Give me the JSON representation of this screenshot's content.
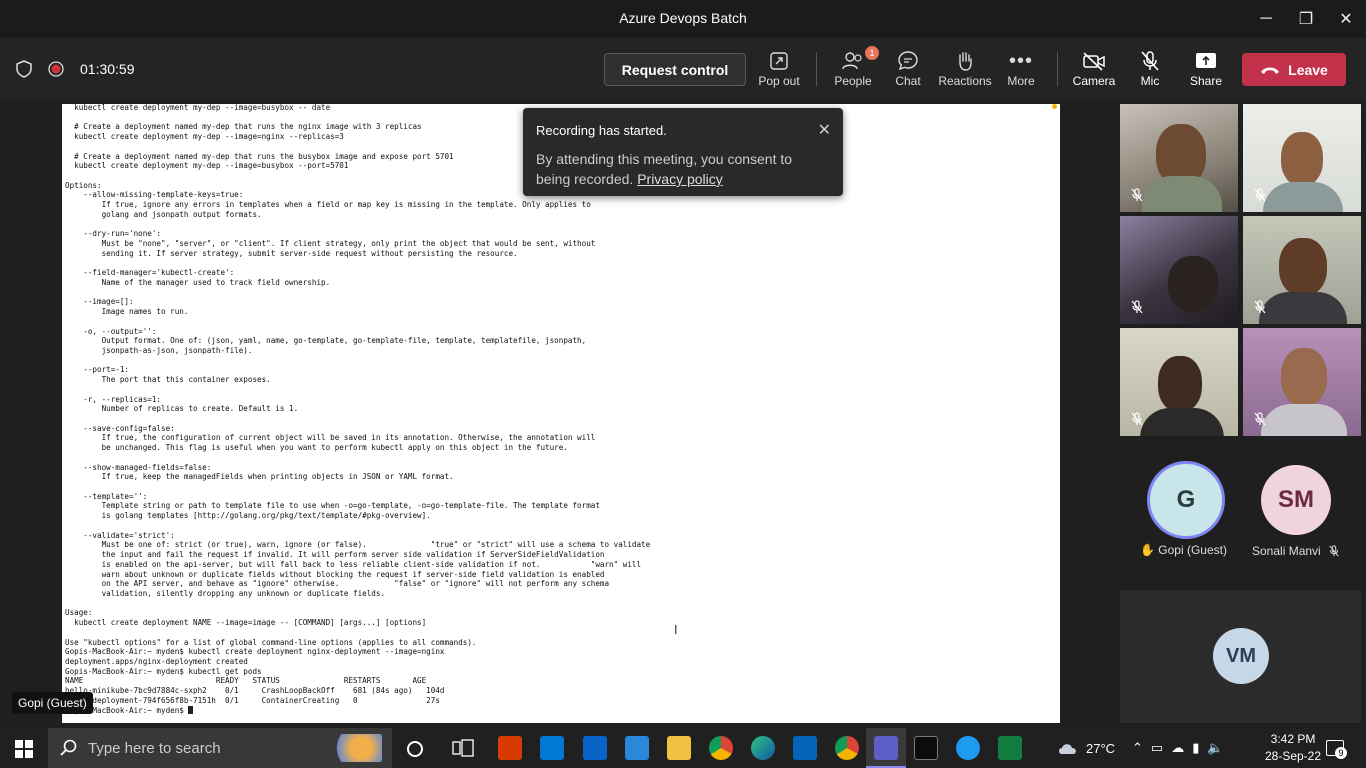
{
  "window": {
    "title": "Azure Devops Batch",
    "minimize": "─",
    "restore": "❐",
    "close": "✕"
  },
  "toolbar": {
    "timer": "01:30:59",
    "request_control": "Request control",
    "pop_out": "Pop out",
    "people": "People",
    "people_badge": "1",
    "chat": "Chat",
    "reactions": "Reactions",
    "more": "More",
    "camera": "Camera",
    "mic": "Mic",
    "share": "Share",
    "leave": "Leave"
  },
  "terminal": {
    "lines": [
      "  kubectl create deployment my-dep --image=busybox -- date",
      "",
      "  # Create a deployment named my-dep that runs the nginx image with 3 replicas",
      "  kubectl create deployment my-dep --image=nginx --replicas=3",
      "",
      "  # Create a deployment named my-dep that runs the busybox image and expose port 5701",
      "  kubectl create deployment my-dep --image=busybox --port=5701",
      "",
      "Options:",
      "    --allow-missing-template-keys=true:",
      "        If true, ignore any errors in templates when a field or map key is missing in the template. Only applies to",
      "        golang and jsonpath output formats.",
      "",
      "    --dry-run='none':",
      "        Must be \"none\", \"server\", or \"client\". If client strategy, only print the object that would be sent, without",
      "        sending it. If server strategy, submit server-side request without persisting the resource.",
      "",
      "    --field-manager='kubectl-create':",
      "        Name of the manager used to track field ownership.",
      "",
      "    --image=[]:",
      "        Image names to run.",
      "",
      "    -o, --output='':",
      "        Output format. One of: (json, yaml, name, go-template, go-template-file, template, templatefile, jsonpath,",
      "        jsonpath-as-json, jsonpath-file).",
      "",
      "    --port=-1:",
      "        The port that this container exposes.",
      "",
      "    -r, --replicas=1:",
      "        Number of replicas to create. Default is 1.",
      "",
      "    --save-config=false:",
      "        If true, the configuration of current object will be saved in its annotation. Otherwise, the annotation will",
      "        be unchanged. This flag is useful when you want to perform kubectl apply on this object in the future.",
      "",
      "    --show-managed-fields=false:",
      "        If true, keep the managedFields when printing objects in JSON or YAML format.",
      "",
      "    --template='':",
      "        Template string or path to template file to use when -o=go-template, -o=go-template-file. The template format",
      "        is golang templates [http://golang.org/pkg/text/template/#pkg-overview].",
      "",
      "    --validate='strict':",
      "        Must be one of: strict (or true), warn, ignore (or false).              \"true\" or \"strict\" will use a schema to validate",
      "        the input and fail the request if invalid. It will perform server side validation if ServerSideFieldValidation",
      "        is enabled on the api-server, but will fall back to less reliable client-side validation if not.           \"warn\" will",
      "        warn about unknown or duplicate fields without blocking the request if server-side field validation is enabled",
      "        on the API server, and behave as \"ignore\" otherwise.            \"false\" or \"ignore\" will not perform any schema",
      "        validation, silently dropping any unknown or duplicate fields.",
      "",
      "Usage:",
      "  kubectl create deployment NAME --image=image -- [COMMAND] [args...] [options]",
      "",
      "Use \"kubectl options\" for a list of global command-line options (applies to all commands).",
      "Gopis-MacBook-Air:~ myden$ kubectl create deployment nginx-deployment --image=nginx",
      "deployment.apps/nginx-deployment created",
      "Gopis-MacBook-Air:~ myden$ kubectl get pods",
      "NAME                             READY   STATUS              RESTARTS       AGE",
      "hello-minikube-7bc9d7884c-sxph2    0/1     CrashLoopBackOff    681 (84s ago)   104d",
      "nginx-deployment-794f656f8b-7151h  0/1     ContainerCreating   0               27s",
      "Gopis-MacBook-Air:~ myden$ "
    ]
  },
  "toast": {
    "title": "Recording has started.",
    "body": "By attending this meeting, you consent to being recorded.",
    "link": "Privacy policy",
    "close": "✕"
  },
  "presenter_tag": "Gopi (Guest)",
  "participants": {
    "gopi": {
      "initial": "G",
      "name": "Gopi (Guest)",
      "hand": "✋"
    },
    "sonali": {
      "initial": "SM",
      "name": "Sonali Manvi"
    },
    "vm": {
      "initial": "VM"
    }
  },
  "taskbar": {
    "search_placeholder": "Type here to search",
    "weather": "27°C",
    "time": "3:42 PM",
    "date": "28-Sep-22",
    "notifications": "9"
  }
}
